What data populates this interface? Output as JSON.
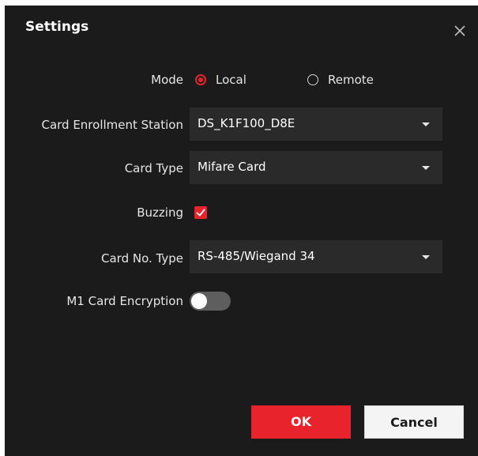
{
  "dialog": {
    "title": "Settings",
    "close_icon": "close-icon"
  },
  "mode": {
    "label": "Mode",
    "options": [
      {
        "label": "Local",
        "selected": true
      },
      {
        "label": "Remote",
        "selected": false
      }
    ]
  },
  "card_enrollment_station": {
    "label": "Card Enrollment Station",
    "value": "DS_K1F100_D8E"
  },
  "card_type": {
    "label": "Card Type",
    "value": "Mifare Card"
  },
  "buzzing": {
    "label": "Buzzing",
    "checked": true
  },
  "card_no_type": {
    "label": "Card No. Type",
    "value": "RS-485/Wiegand 34"
  },
  "m1_card_encryption": {
    "label": "M1 Card Encryption",
    "enabled": false
  },
  "buttons": {
    "ok": "OK",
    "cancel": "Cancel"
  },
  "colors": {
    "accent": "#e8232c",
    "background": "#1b1b1b",
    "field": "#2a2a2a"
  }
}
